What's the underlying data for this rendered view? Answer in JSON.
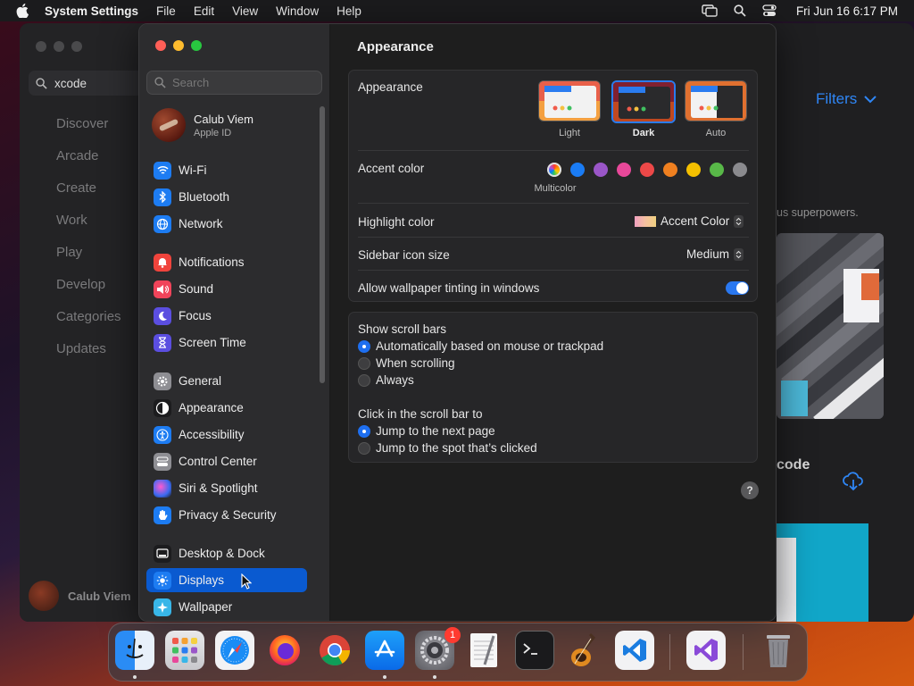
{
  "menubar": {
    "app_name": "System Settings",
    "menus": [
      "File",
      "Edit",
      "View",
      "Window",
      "Help"
    ],
    "clock": "Fri Jun 16  6:17 PM"
  },
  "background_app": {
    "search_value": "xcode",
    "nav": [
      "Discover",
      "Arcade",
      "Create",
      "Work",
      "Play",
      "Develop",
      "Categories",
      "Updates"
    ],
    "user_name": "Calub Viem",
    "filters_label": "Filters",
    "partial_text": "us superpowers.",
    "partial_label": "code"
  },
  "settings": {
    "search_placeholder": "Search",
    "profile": {
      "name": "Calub Viem",
      "subtitle": "Apple ID"
    },
    "sidebar": [
      {
        "label": "Wi-Fi",
        "icon": "wifi-icon",
        "color": "#1d7cf2"
      },
      {
        "label": "Bluetooth",
        "icon": "bluetooth-icon",
        "color": "#1d7cf2"
      },
      {
        "label": "Network",
        "icon": "globe-icon",
        "color": "#1d7cf2"
      },
      {
        "label": "Notifications",
        "icon": "bell-icon",
        "color": "#f0443c"
      },
      {
        "label": "Sound",
        "icon": "speaker-icon",
        "color": "#f0445a"
      },
      {
        "label": "Focus",
        "icon": "moon-icon",
        "color": "#5b4ee0"
      },
      {
        "label": "Screen Time",
        "icon": "hourglass-icon",
        "color": "#5b4ee0"
      },
      {
        "label": "General",
        "icon": "gear-icon",
        "color": "#8e8e93"
      },
      {
        "label": "Appearance",
        "icon": "appearance-icon",
        "color": "#1c1c1e"
      },
      {
        "label": "Accessibility",
        "icon": "accessibility-icon",
        "color": "#1d7cf2"
      },
      {
        "label": "Control Center",
        "icon": "control-center-icon",
        "color": "#8e8e93"
      },
      {
        "label": "Siri & Spotlight",
        "icon": "siri-icon",
        "color": "#7a3ad8"
      },
      {
        "label": "Privacy & Security",
        "icon": "hand-icon",
        "color": "#1d7cf2"
      },
      {
        "label": "Desktop & Dock",
        "icon": "dock-icon",
        "color": "#1c1c1e"
      },
      {
        "label": "Displays",
        "icon": "sun-icon",
        "color": "#1d7cf2",
        "selected": true
      },
      {
        "label": "Wallpaper",
        "icon": "wallpaper-icon",
        "color": "#38b6e8"
      }
    ],
    "page_title": "Appearance",
    "appearance": {
      "label": "Appearance",
      "options": [
        "Light",
        "Dark",
        "Auto"
      ],
      "selected": "Dark"
    },
    "accent": {
      "label": "Accent color",
      "selected_name": "Multicolor",
      "colors": [
        "#d040d8",
        "#1a7cf5",
        "#9a56c8",
        "#e8489a",
        "#ec4848",
        "#f08020",
        "#f5c000",
        "#58b848",
        "#8a8a8e"
      ]
    },
    "highlight": {
      "label": "Highlight color",
      "value": "Accent Color"
    },
    "icon_size": {
      "label": "Sidebar icon size",
      "value": "Medium"
    },
    "tinting": {
      "label": "Allow wallpaper tinting in windows",
      "on": true
    },
    "scroll_bars": {
      "label": "Show scroll bars",
      "options": [
        "Automatically based on mouse or trackpad",
        "When scrolling",
        "Always"
      ],
      "selected": 0
    },
    "click_scroll": {
      "label": "Click in the scroll bar to",
      "options": [
        "Jump to the next page",
        "Jump to the spot that’s clicked"
      ],
      "selected": 0
    },
    "help": "?"
  },
  "dock": {
    "apps": [
      "Finder",
      "Launchpad",
      "Safari",
      "Firefox",
      "Chrome",
      "App Store",
      "System Settings",
      "TextEdit",
      "Terminal",
      "GarageBand",
      "VS Code",
      "Visual Studio",
      "Trash"
    ],
    "settings_badge": "1"
  }
}
